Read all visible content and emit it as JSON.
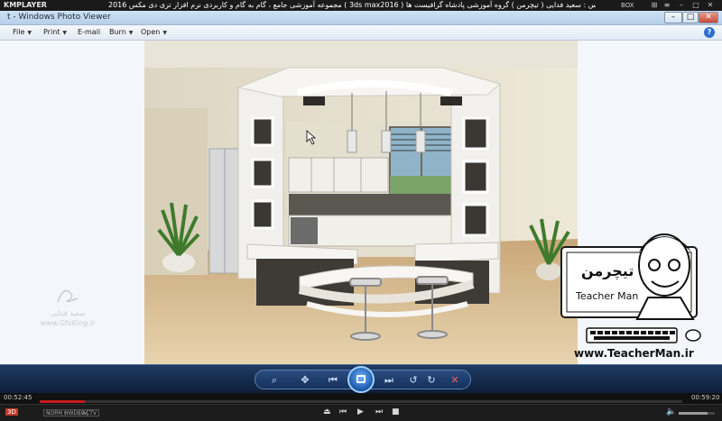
{
  "kmplayer": {
    "logo": "KMPLAYER",
    "caption": "مجموعه آموزشی جامع ، گام به گام و کاربردی نرم افزار تری دی مکس 2016 ( 3ds max2016 )   مدرس : سعید فدایی ( تیچرمن ) گروه آموزشی پادشاه گرافیست ها",
    "box_label": "BOX",
    "time_elapsed": "00:52:45",
    "time_total": "00:59:20",
    "seek_progress": 0.07,
    "volume_level": 0.8,
    "tags": [
      "3D",
      "NORM",
      "HWDEC",
      "ACTV",
      "BOX"
    ],
    "control_glyphs": {
      "eject": "⏏",
      "prev": "⏮",
      "play": "▶",
      "next": "⏭",
      "stop": "■",
      "volume": "🔈"
    }
  },
  "photo_viewer": {
    "title": "t - Windows Photo Viewer",
    "menus": [
      {
        "label": "File"
      },
      {
        "label": "Print"
      },
      {
        "label": "E-mail"
      },
      {
        "label": "Burn"
      },
      {
        "label": "Open"
      }
    ],
    "help_glyph": "?",
    "toolbar_glyphs": {
      "zoom": "⌕",
      "actual_size": "✥",
      "previous": "⏮",
      "next": "⏭",
      "rotate_ccw": "↺",
      "rotate_cw": "↻",
      "delete": "✕"
    }
  },
  "watermarks": {
    "left_lines": [
      "سعید فدایی",
      "www.GfxKing.ir"
    ],
    "teacher_name": "Teacher Man",
    "teacher_brand": "تیچرمن",
    "teacher_site": "www.TeacherMan.ir"
  },
  "colors": {
    "accent": "#1b57a8",
    "seek_red": "#c81c1c"
  }
}
